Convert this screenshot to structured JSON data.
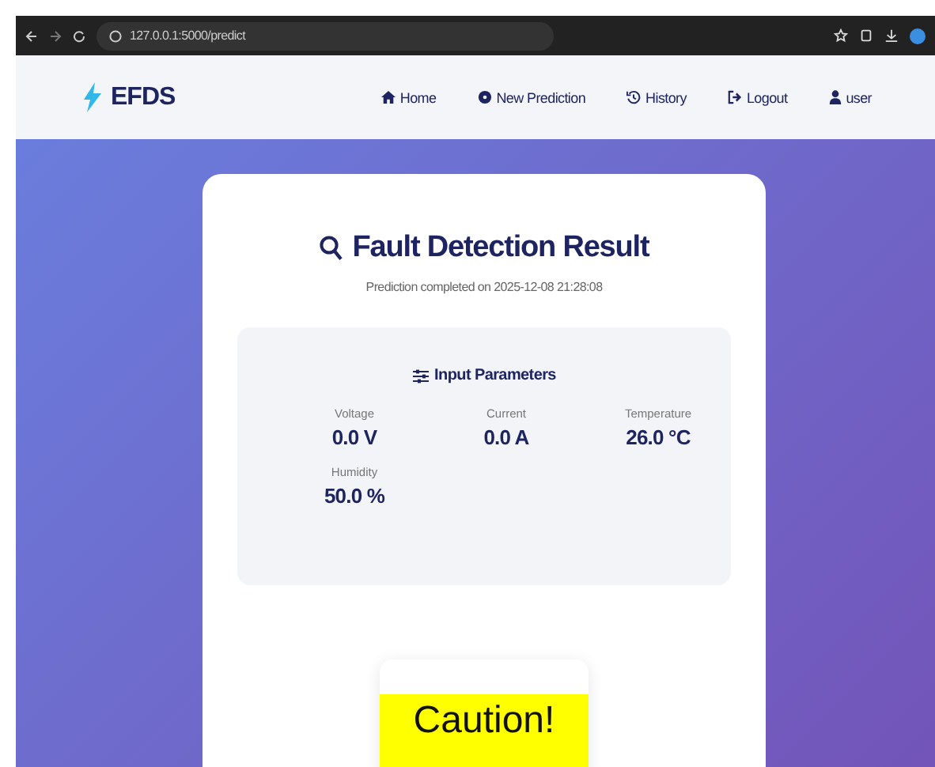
{
  "browser": {
    "url": "127.0.0.1:5000/predict"
  },
  "navbar": {
    "brand": "EFDS",
    "links": [
      {
        "label": "Home",
        "kind": "home"
      },
      {
        "label": "New Prediction",
        "kind": "predict"
      },
      {
        "label": "History",
        "kind": "history"
      },
      {
        "label": "Logout",
        "kind": "logout"
      },
      {
        "label": "user",
        "kind": "account"
      }
    ]
  },
  "result": {
    "title": "Fault Detection Result",
    "subtitle": "Prediction completed on 2025-12-08 21:28:08",
    "parameters": {
      "title": "Input Parameters",
      "items": [
        {
          "label": "Voltage",
          "value": "0.0 V"
        },
        {
          "label": "Current",
          "value": "0.0 A"
        },
        {
          "label": "Temperature",
          "value": "26.0 °C"
        },
        {
          "label": "Humidity",
          "value": "50.0 %"
        }
      ]
    },
    "sign": {
      "text": "Caution!"
    }
  }
}
